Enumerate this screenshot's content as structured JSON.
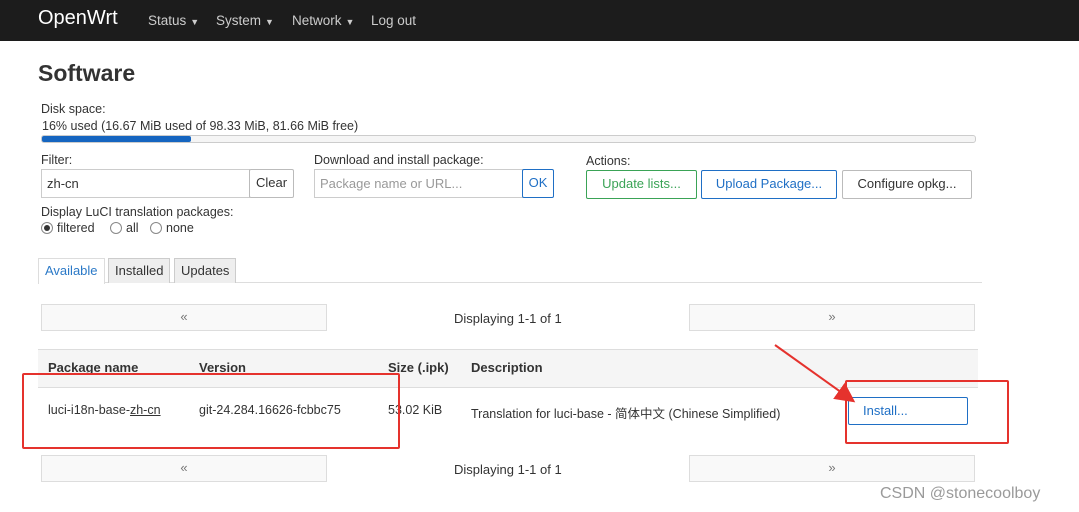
{
  "navbar": {
    "brand": "OpenWrt",
    "menu": [
      "Status",
      "System",
      "Network",
      "Log out"
    ]
  },
  "page_title": "Software",
  "disk": {
    "label": "Disk space:",
    "text": "16% used (16.67 MiB used of 98.33 MiB, 81.66 MiB free)",
    "percent": 16
  },
  "filter": {
    "label": "Filter:",
    "value": "zh-cn",
    "clear_label": "Clear"
  },
  "download": {
    "label": "Download and install package:",
    "placeholder": "Package name or URL...",
    "ok_label": "OK"
  },
  "actions": {
    "label": "Actions:",
    "update": "Update lists...",
    "upload": "Upload Package...",
    "configure": "Configure opkg..."
  },
  "translation": {
    "label": "Display LuCI translation packages:",
    "options": [
      "filtered",
      "all",
      "none"
    ],
    "selected": "filtered"
  },
  "tabs": [
    "Available",
    "Installed",
    "Updates"
  ],
  "pager": {
    "prev": "«",
    "next": "»",
    "display": "Displaying 1-1 of 1"
  },
  "table": {
    "headers": [
      "Package name",
      "Version",
      "Size (.ipk)",
      "Description"
    ],
    "row": {
      "name_prefix": "luci-i18n-base-",
      "name_suffix": "zh-cn",
      "version": "git-24.284.16626-fcbbc75",
      "size": "53.02 KiB",
      "description": "Translation for luci-base - 简体中文 (Chinese Simplified)",
      "action": "Install..."
    }
  },
  "watermark": "CSDN @stonecoolboy"
}
